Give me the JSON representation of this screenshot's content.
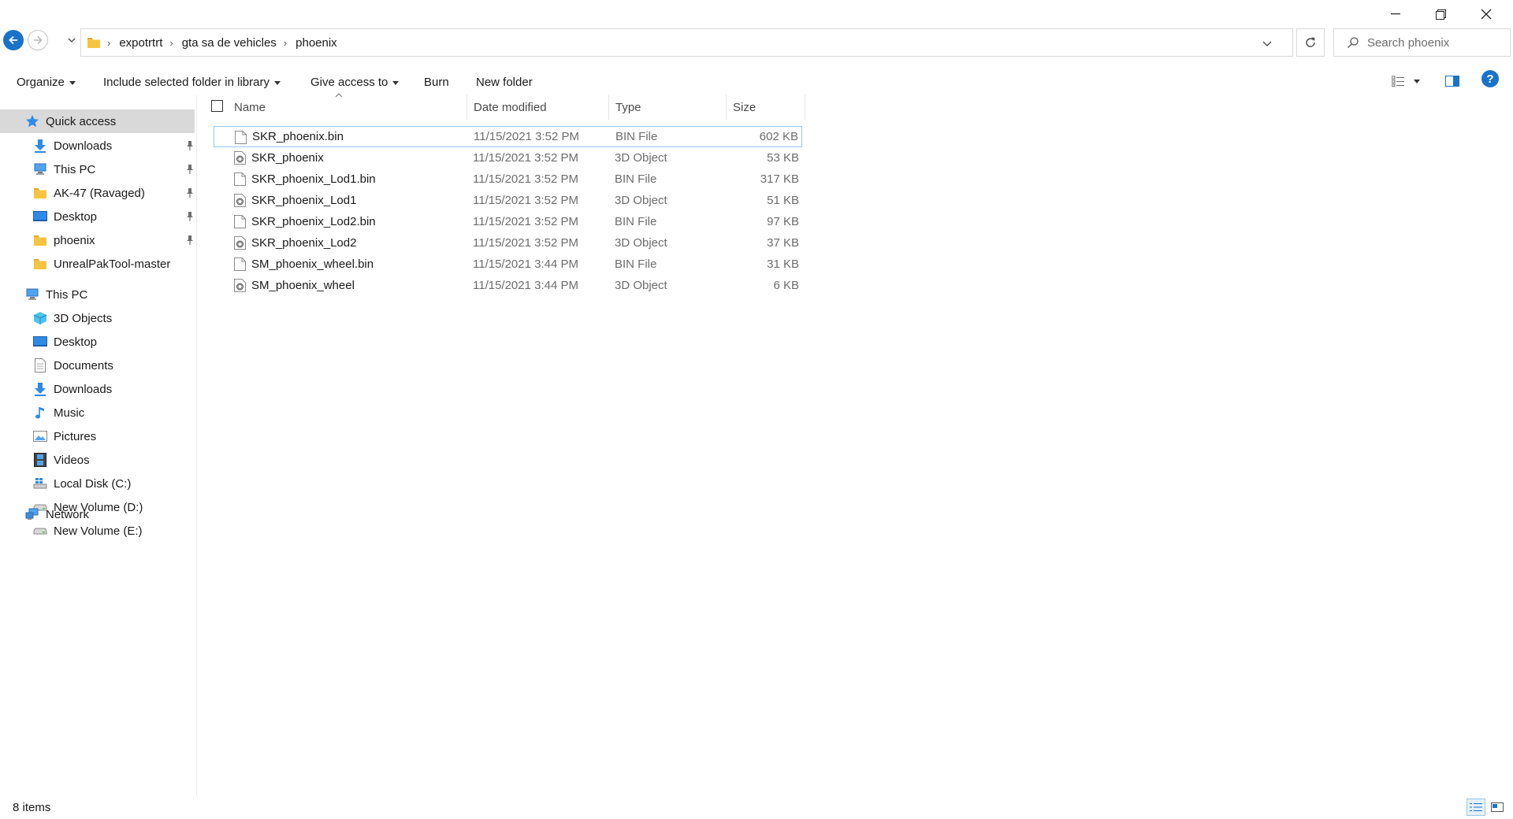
{
  "address": {
    "breadcrumbs": [
      "expotrtrt",
      "gta sa de vehicles",
      "phoenix"
    ]
  },
  "search": {
    "placeholder": "Search phoenix"
  },
  "toolbar": {
    "organize": "Organize",
    "include_library": "Include selected folder in library",
    "give_access": "Give access to",
    "burn": "Burn",
    "new_folder": "New folder"
  },
  "sidebar": {
    "quick_access": "Quick access",
    "quick_items": [
      {
        "label": "Downloads",
        "icon": "download-arrow-icon",
        "pinned": true
      },
      {
        "label": "This PC",
        "icon": "computer-icon",
        "pinned": true
      },
      {
        "label": "AK-47 (Ravaged)",
        "icon": "folder-icon",
        "pinned": true
      },
      {
        "label": "Desktop",
        "icon": "desktop-icon",
        "pinned": true
      },
      {
        "label": "phoenix",
        "icon": "folder-icon",
        "pinned": true
      },
      {
        "label": "UnrealPakTool-master",
        "icon": "folder-icon",
        "pinned": false
      }
    ],
    "this_pc": "This PC",
    "pc_items": [
      {
        "label": "3D Objects",
        "icon": "cube-icon"
      },
      {
        "label": "Desktop",
        "icon": "desktop-icon"
      },
      {
        "label": "Documents",
        "icon": "document-icon"
      },
      {
        "label": "Downloads",
        "icon": "download-arrow-icon"
      },
      {
        "label": "Music",
        "icon": "music-note-icon"
      },
      {
        "label": "Pictures",
        "icon": "picture-icon"
      },
      {
        "label": "Videos",
        "icon": "film-icon"
      },
      {
        "label": "Local Disk (C:)",
        "icon": "windows-drive-icon"
      },
      {
        "label": "New Volume (D:)",
        "icon": "drive-icon"
      },
      {
        "label": "New Volume (E:)",
        "icon": "drive-icon"
      }
    ],
    "network": "Network"
  },
  "columns": {
    "name": "Name",
    "date": "Date modified",
    "type": "Type",
    "size": "Size"
  },
  "files": [
    {
      "name": "SKR_phoenix.bin",
      "date": "11/15/2021 3:52 PM",
      "type": "BIN File",
      "size": "602 KB",
      "icon": "blank-file-icon"
    },
    {
      "name": "SKR_phoenix",
      "date": "11/15/2021 3:52 PM",
      "type": "3D Object",
      "size": "53 KB",
      "icon": "3d-object-file-icon"
    },
    {
      "name": "SKR_phoenix_Lod1.bin",
      "date": "11/15/2021 3:52 PM",
      "type": "BIN File",
      "size": "317 KB",
      "icon": "blank-file-icon"
    },
    {
      "name": "SKR_phoenix_Lod1",
      "date": "11/15/2021 3:52 PM",
      "type": "3D Object",
      "size": "51 KB",
      "icon": "3d-object-file-icon"
    },
    {
      "name": "SKR_phoenix_Lod2.bin",
      "date": "11/15/2021 3:52 PM",
      "type": "BIN File",
      "size": "97 KB",
      "icon": "blank-file-icon"
    },
    {
      "name": "SKR_phoenix_Lod2",
      "date": "11/15/2021 3:52 PM",
      "type": "3D Object",
      "size": "37 KB",
      "icon": "3d-object-file-icon"
    },
    {
      "name": "SM_phoenix_wheel.bin",
      "date": "11/15/2021 3:44 PM",
      "type": "BIN File",
      "size": "31 KB",
      "icon": "blank-file-icon"
    },
    {
      "name": "SM_phoenix_wheel",
      "date": "11/15/2021 3:44 PM",
      "type": "3D Object",
      "size": "6 KB",
      "icon": "3d-object-file-icon"
    }
  ],
  "status": {
    "item_count": "8 items"
  },
  "colors": {
    "accent": "#1a73c9",
    "selected_nav": "#d9d9d9",
    "row_focus_border": "#99c6eb",
    "folder_yellow": "#f5c542"
  }
}
